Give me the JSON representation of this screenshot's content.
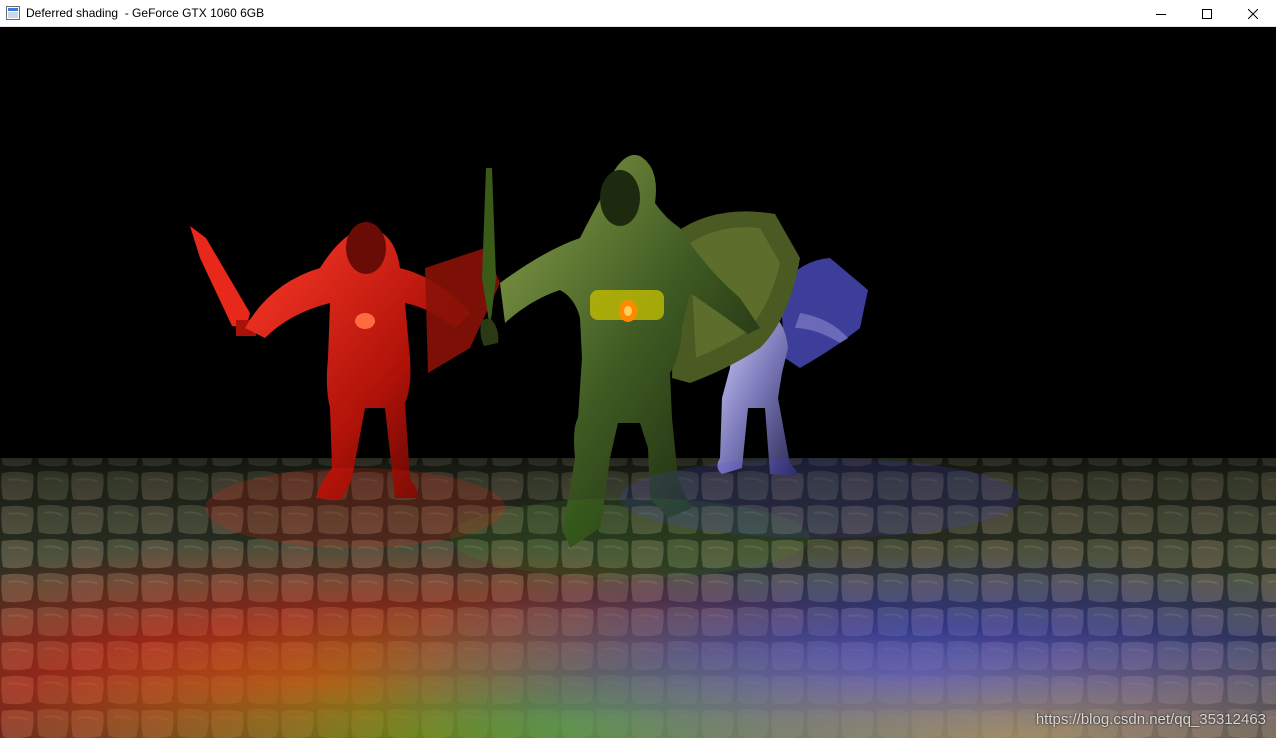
{
  "window": {
    "title": "Deferred shading  - GeForce GTX 1060 6GB",
    "icon": "window-app-icon",
    "controls": {
      "minimize_icon": "minimize-icon",
      "maximize_icon": "maximize-icon",
      "close_icon": "close-icon"
    }
  },
  "scene": {
    "light_colors": {
      "red": "#ff1a10",
      "green": "#39c81c",
      "blue": "#3a3aff"
    },
    "figures": [
      "red-knight",
      "green-knight",
      "blue-knight"
    ]
  },
  "watermark": "https://blog.csdn.net/qq_35312463"
}
